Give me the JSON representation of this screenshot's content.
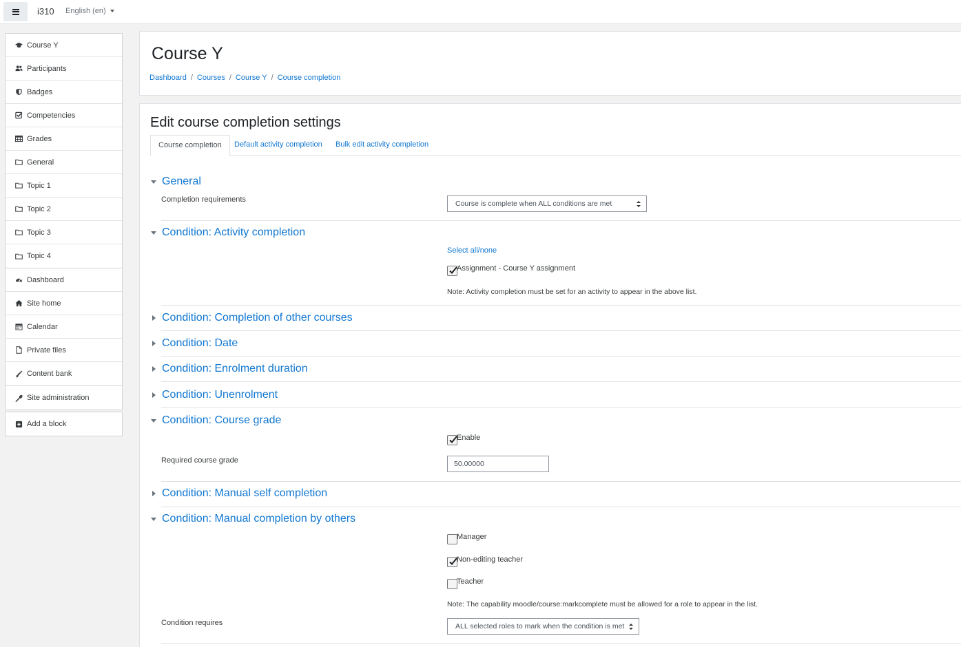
{
  "navbar": {
    "site_name": "i310",
    "language": "English (en)"
  },
  "sidebar": {
    "course_items": [
      {
        "label": "Course Y",
        "icon": "graduation-cap-icon"
      },
      {
        "label": "Participants",
        "icon": "users-icon"
      },
      {
        "label": "Badges",
        "icon": "shield-icon"
      },
      {
        "label": "Competencies",
        "icon": "check-square-icon"
      },
      {
        "label": "Grades",
        "icon": "table-icon"
      },
      {
        "label": "General",
        "icon": "folder-icon"
      },
      {
        "label": "Topic 1",
        "icon": "folder-icon"
      },
      {
        "label": "Topic 2",
        "icon": "folder-icon"
      },
      {
        "label": "Topic 3",
        "icon": "folder-icon"
      },
      {
        "label": "Topic 4",
        "icon": "folder-icon"
      }
    ],
    "site_items": [
      {
        "label": "Dashboard",
        "icon": "tachometer-icon"
      },
      {
        "label": "Site home",
        "icon": "home-icon"
      },
      {
        "label": "Calendar",
        "icon": "calendar-icon"
      },
      {
        "label": "Private files",
        "icon": "file-icon"
      },
      {
        "label": "Content bank",
        "icon": "paint-brush-icon"
      }
    ],
    "admin_item": {
      "label": "Site administration",
      "icon": "wrench-icon"
    },
    "block_item": {
      "label": "Add a block",
      "icon": "plus-square-icon"
    }
  },
  "header": {
    "course_title": "Course Y",
    "breadcrumb": [
      "Dashboard",
      "Courses",
      "Course Y",
      "Course completion"
    ]
  },
  "main": {
    "form_title": "Edit course completion settings",
    "tabs": [
      "Course completion",
      "Default activity completion",
      "Bulk edit activity completion"
    ],
    "sections": {
      "general": "General",
      "activity": "Condition: Activity completion",
      "other_courses": "Condition: Completion of other courses",
      "date": "Condition: Date",
      "enrolment": "Condition: Enrolment duration",
      "unenrolment": "Condition: Unenrolment",
      "course_grade": "Condition: Course grade",
      "self_completion": "Condition: Manual self completion",
      "by_others": "Condition: Manual completion by others"
    },
    "general": {
      "requirements_label": "Completion requirements",
      "requirements_value": "Course is complete when ALL conditions are met"
    },
    "activity": {
      "select_all": "Select all/none",
      "assignment_label": "Assignment - Course Y assignment",
      "assignment_checked": true,
      "note": "Note: Activity completion must be set for an activity to appear in the above list."
    },
    "course_grade": {
      "enable_label": "Enable",
      "enable_checked": true,
      "required_label": "Required course grade",
      "required_value": "50.00000"
    },
    "by_others": {
      "roles": [
        {
          "label": "Manager",
          "checked": false
        },
        {
          "label": "Non-editing teacher",
          "checked": true
        },
        {
          "label": "Teacher",
          "checked": false
        }
      ],
      "note": "Note: The capability moodle/course:markcomplete must be allowed for a role to appear in the list.",
      "requires_label": "Condition requires",
      "requires_value": "ALL selected roles to mark when the condition is met"
    }
  }
}
